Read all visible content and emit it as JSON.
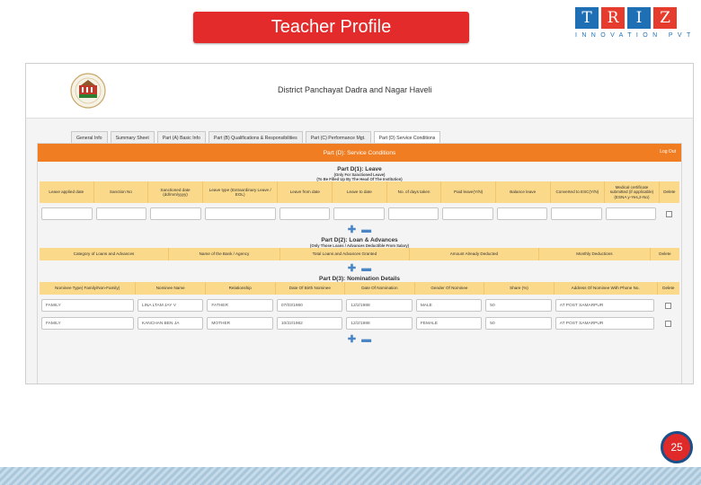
{
  "slide": {
    "title": "Teacher Profile",
    "page_number": "25",
    "logo": {
      "letters": [
        "T",
        "R",
        "I",
        "Z"
      ],
      "tagline": "INNOVATION PVT LTD",
      "colors": [
        "#1f6fb5",
        "#e63c2d",
        "#1f6fb5",
        "#e63c2d"
      ]
    }
  },
  "app": {
    "org_title": "District Panchayat Dadra and Nagar Haveli",
    "tabs": [
      "General Info",
      "Summary Sheet",
      "Part (A) Basic Info",
      "Part (B) Qualifications & Responsibilities",
      "Part (C) Performance Mgt.",
      "Part (D) Service Conditions"
    ],
    "active_tab": 5,
    "panel_title": "Part (D): Service Conditions",
    "logout": "Log Out",
    "leave": {
      "title": "Part D(1): Leave",
      "sub1": "(Only For Sanctioned Leave)",
      "sub2": "(To Be Filled Up By The Head Of The Institution)",
      "headers": [
        "Leave applied date",
        "Sanction No",
        "Sanctioned date (dd/mm/yyyy)",
        "Leave type (Extraordinary Leave / EOL)",
        "Leave from date",
        "Leave to date",
        "No. of days taken",
        "Paid leave(Y/N)",
        "Balance leave",
        "Converted to ESC(Y/N)",
        "Medical certificate submitted (if applicable) (ESNA y-Yes,2-No)",
        "Delete"
      ]
    },
    "loans": {
      "title": "Part D(2): Loan & Advances",
      "sub": "(Only Those Loans / Advances Deductible From Salary)",
      "headers": [
        "Category of Loans and Advances",
        "Name of the Bank / Agency",
        "Total Loans and Advances Granted",
        "Amount Already Deducted",
        "Monthly Deductions",
        "Delete"
      ]
    },
    "nomination": {
      "title": "Part D(3): Nomination Details",
      "headers": [
        "Nominee Type( Family/Non-Family)",
        "Nominee Name",
        "Relationship",
        "Date Of Birth Nominee",
        "Date Of Nomination",
        "Gender Of Nominee",
        "Share (%)",
        "Address Of Nominee With Phone No.",
        "Delete"
      ],
      "rows": [
        [
          "FAMILY",
          "LINA LTAM JAY V",
          "FATHER",
          "07/03/1960",
          "12/2/1988",
          "MALE",
          "50",
          "AT POST SAMARPUR"
        ],
        [
          "FAMILY",
          "KANCHAN BEN JA",
          "MOTHER",
          "10/22/1962",
          "12/2/1988",
          "FEMALE",
          "50",
          "AT POST SAMARPUR"
        ]
      ]
    },
    "add_symbol": "✚",
    "remove_symbol": "▬"
  }
}
